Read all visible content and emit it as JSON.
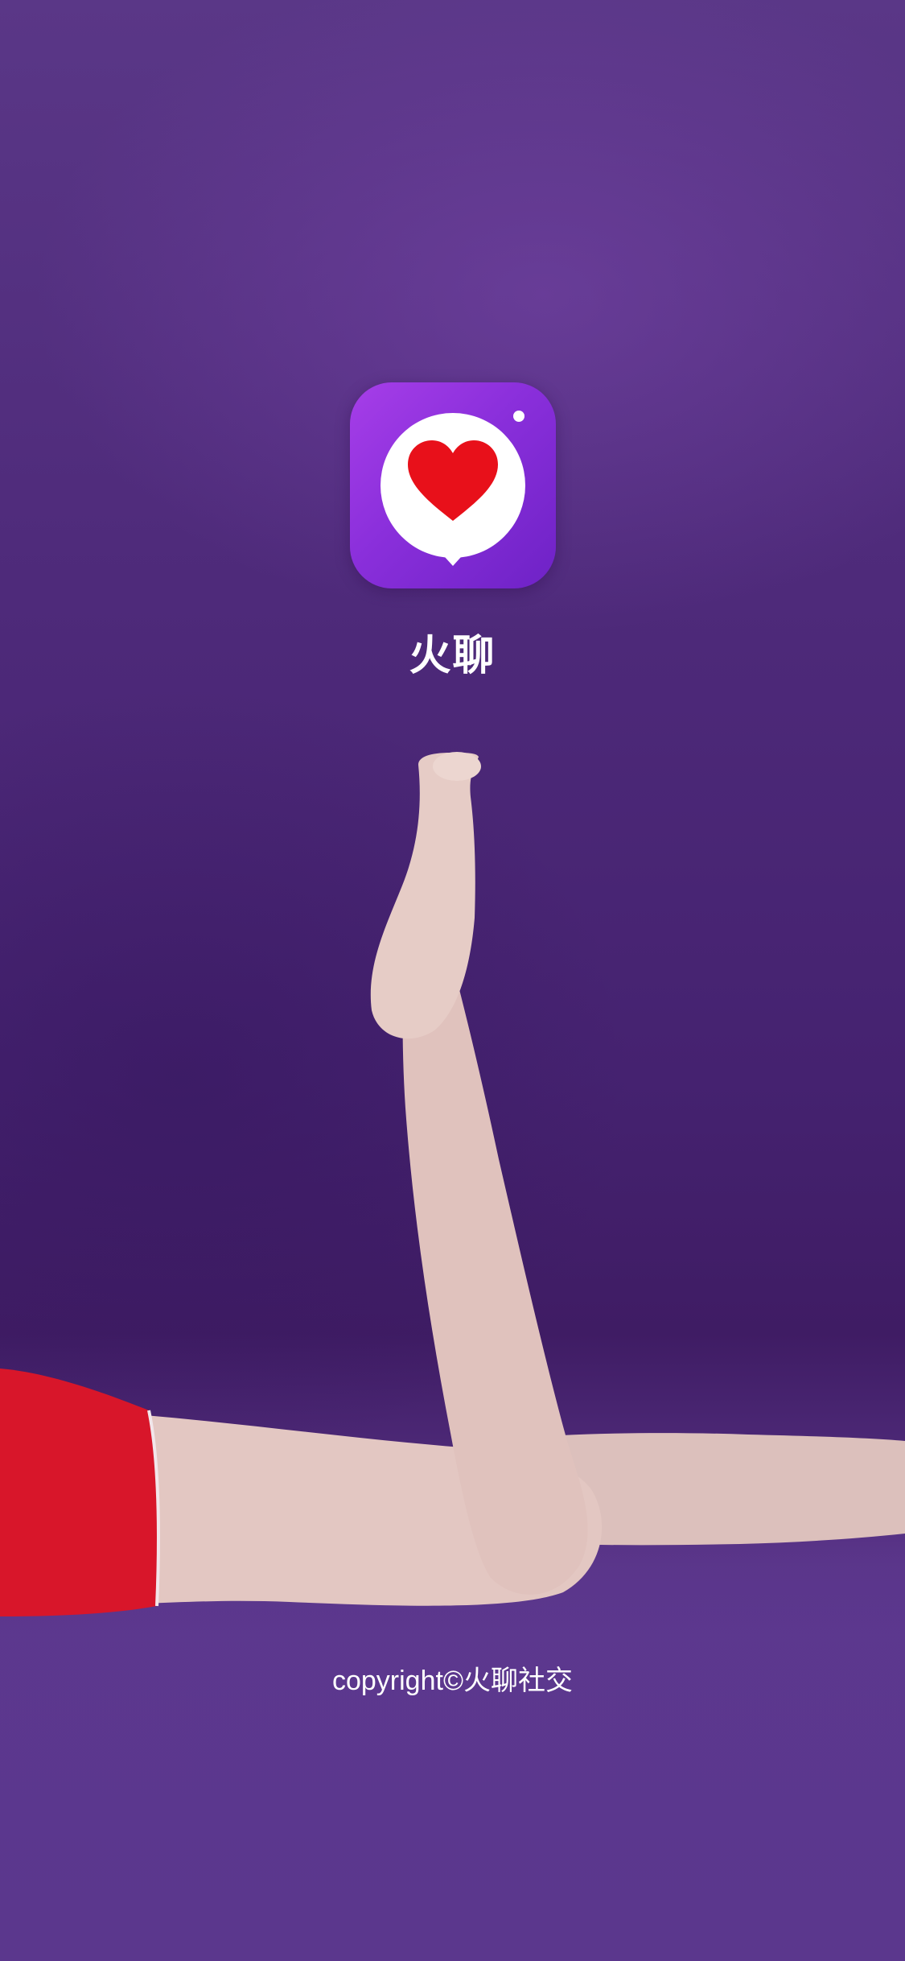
{
  "app": {
    "name": "火聊",
    "icon": "heart-chat-bubble-icon",
    "icon_gradient_start": "#a63ee8",
    "icon_gradient_end": "#6e22c6",
    "heart_color": "#e8101a"
  },
  "background": {
    "image": "photo-legs-on-purple-backdrop",
    "base_color": "#4f2a78",
    "shorts_color": "#d8162a"
  },
  "footer": {
    "copyright": "copyright©火聊社交"
  }
}
